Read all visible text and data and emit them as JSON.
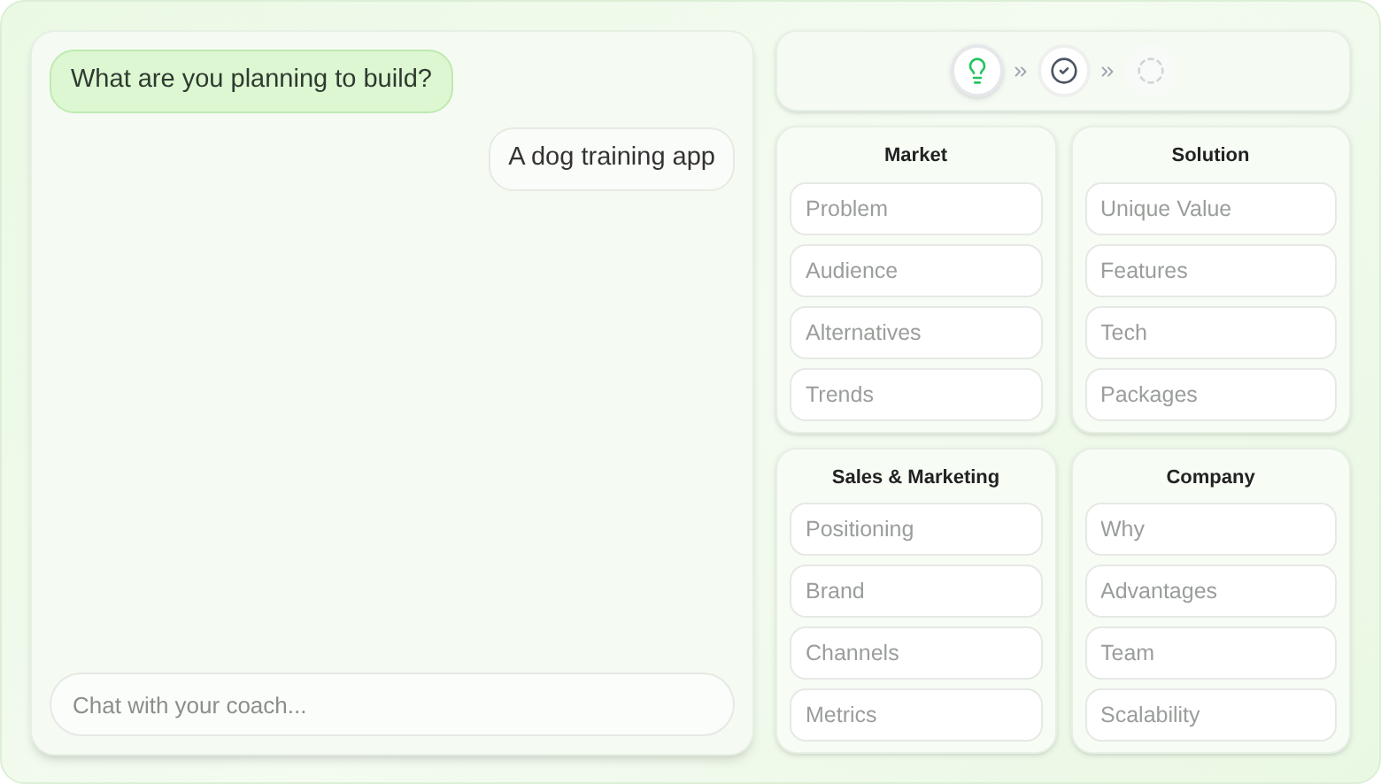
{
  "chat": {
    "messages": [
      {
        "kind": "coach",
        "text": "What are you planning to build?"
      },
      {
        "kind": "user",
        "text": "A dog training app"
      }
    ],
    "input": {
      "placeholder": "Chat with your coach..."
    }
  },
  "steps": [
    {
      "kind": "active"
    },
    {
      "kind": "done"
    },
    {
      "kind": "pending"
    }
  ],
  "sections": [
    {
      "title": "Market",
      "fields": [
        {
          "placeholder": "Problem"
        },
        {
          "placeholder": "Audience"
        },
        {
          "placeholder": "Alternatives"
        },
        {
          "placeholder": "Trends"
        }
      ]
    },
    {
      "title": "Solution",
      "fields": [
        {
          "placeholder": "Unique Value"
        },
        {
          "placeholder": "Features"
        },
        {
          "placeholder": "Tech"
        },
        {
          "placeholder": "Packages"
        }
      ]
    },
    {
      "title": "Sales & Marketing",
      "fields": [
        {
          "placeholder": "Positioning"
        },
        {
          "placeholder": "Brand"
        },
        {
          "placeholder": "Channels"
        },
        {
          "placeholder": "Metrics"
        }
      ]
    },
    {
      "title": "Company",
      "fields": [
        {
          "placeholder": "Why"
        },
        {
          "placeholder": "Advantages"
        },
        {
          "placeholder": "Team"
        },
        {
          "placeholder": "Scalability"
        }
      ]
    }
  ]
}
